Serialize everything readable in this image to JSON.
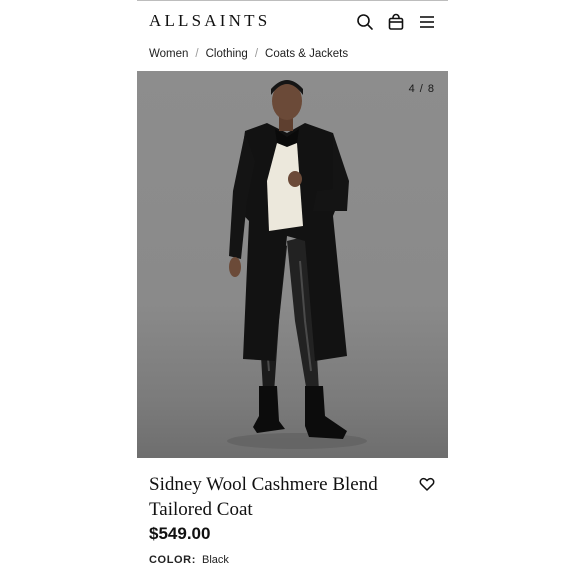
{
  "header": {
    "brand": "ALLSAINTS",
    "icons": [
      "search-icon",
      "bag-icon",
      "menu-icon"
    ]
  },
  "breadcrumb": {
    "items": [
      "Women",
      "Clothing",
      "Coats & Jackets"
    ],
    "separator": "/"
  },
  "gallery": {
    "counter": "4 / 8"
  },
  "product": {
    "title_line1": "Sidney Wool Cashmere Blend",
    "title_line2": "Tailored Coat",
    "price": "$549.00",
    "color_label": "COLOR:",
    "color_value": "Black"
  },
  "colors": {
    "text": "#111111",
    "photo_background": "#8b8b8b",
    "coat": "#121212"
  }
}
